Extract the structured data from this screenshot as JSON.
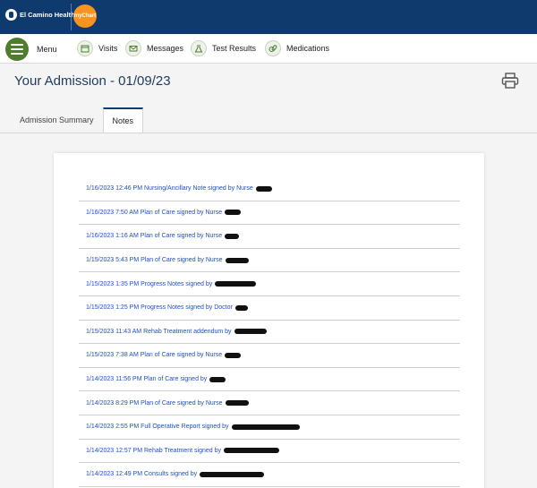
{
  "header": {
    "brand": "El Camino Health",
    "app_badge": "myChart",
    "brand_color": "#0e3a6e",
    "accent_color": "#f7931e"
  },
  "nav": {
    "menu_label": "Menu",
    "items": [
      {
        "label": "Visits",
        "icon": "calendar-icon"
      },
      {
        "label": "Messages",
        "icon": "envelope-icon"
      },
      {
        "label": "Test Results",
        "icon": "flask-icon"
      },
      {
        "label": "Medications",
        "icon": "pills-icon"
      }
    ],
    "icon_color": "#4e7d2d"
  },
  "page": {
    "title": "Your Admission - 01/09/23"
  },
  "tabs": [
    {
      "label": "Admission Summary",
      "active": false
    },
    {
      "label": "Notes",
      "active": true
    }
  ],
  "notes": [
    {
      "text": "1/16/2023 12:46 PM Nursing/Ancillary Note signed by Nurse"
    },
    {
      "text": "1/16/2023  7:50 AM Plan of Care signed by Nurse"
    },
    {
      "text": "1/16/2023  1:16 AM Plan of Care signed by Nurse"
    },
    {
      "text": "1/15/2023  5:43 PM Plan of Care signed by Nurse"
    },
    {
      "text": "1/15/2023  1:35 PM Progress Notes signed by"
    },
    {
      "text": "1/15/2023  1:25 PM Progress Notes signed by Doctor"
    },
    {
      "text": "1/15/2023 11:43 AM Rehab Treatment addendum by"
    },
    {
      "text": "1/15/2023  7:38 AM Plan of Care signed by Nurse"
    },
    {
      "text": "1/14/2023 11:56 PM Plan of Care signed by"
    },
    {
      "text": "1/14/2023  8:29 PM Plan of Care signed by Nurse"
    },
    {
      "text": "1/14/2023  2:55 PM Full Operative Report signed by"
    },
    {
      "text": "1/14/2023 12:57 PM Rehab Treatment signed by"
    },
    {
      "text": "1/14/2023 12:49 PM Consults signed by"
    }
  ],
  "link_color": "#1f4fc2"
}
